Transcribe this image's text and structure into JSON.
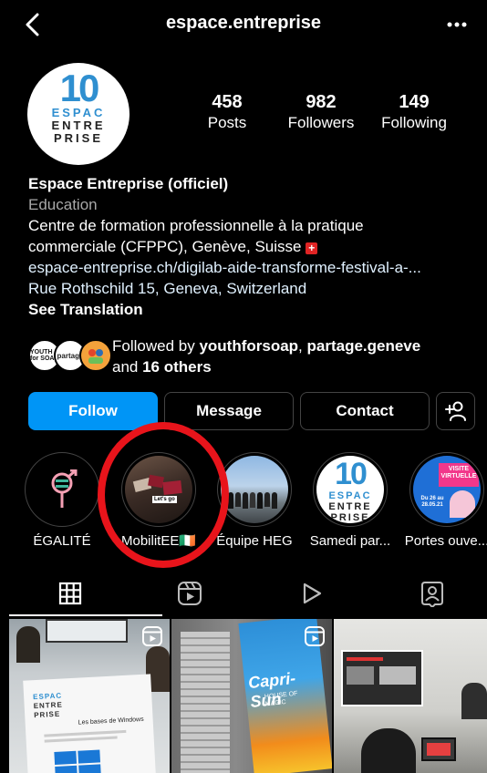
{
  "header": {
    "title": "espace.entreprise"
  },
  "profile": {
    "avatar_logo": {
      "number": "10",
      "line1": "ESPAC",
      "line2": "ENTRE",
      "line3": "PRISE"
    },
    "stats": [
      {
        "value": "458",
        "label": "Posts"
      },
      {
        "value": "982",
        "label": "Followers"
      },
      {
        "value": "149",
        "label": "Following"
      }
    ],
    "name": "Espace Entreprise (officiel)",
    "category": "Education",
    "bio_line1": "Centre de formation professionnelle à la pratique",
    "bio_line2": "commerciale (CFPPC), Genève, Suisse",
    "flag_glyph": "+",
    "link": "espace-entreprise.ch/digilab-aide-transforme-festival-a-...",
    "address": "Rue Rothschild 15, Geneva, Switzerland",
    "see_translation": "See Translation"
  },
  "followed_by": {
    "prefix": "Followed by ",
    "user1": "youthforsoap",
    "sep": ", ",
    "user2": "partage.geneve",
    "line2_prefix": "and ",
    "others": "16 others",
    "avatar1_text": "YOUTH for SOAP",
    "avatar2_text": "partage"
  },
  "buttons": {
    "follow": "Follow",
    "message": "Message",
    "contact": "Contact"
  },
  "highlights": [
    {
      "label": "ÉGALITÉ"
    },
    {
      "label": "MobilitEE🇮🇪",
      "inner_text": "Let's go"
    },
    {
      "label": "Équipe HEG"
    },
    {
      "label": "Samedi par..."
    },
    {
      "label": "Portes ouve...",
      "inner_text1": "VISITE VIRTUELLE",
      "inner_text2": "Du 26 au 28.05.21"
    }
  ],
  "posts": [
    {
      "doc_title": "Les bases de Windows",
      "logo_line1": "ESPAC",
      "logo_line2": "ENTRE",
      "logo_line3": "PRISE"
    },
    {
      "text": "Capri-Sun",
      "sub": "HOUSE OF MAGIC"
    },
    {
      "text": ""
    }
  ],
  "colors": {
    "accent": "#0095f6",
    "highlight_circle": "#e8141b",
    "logo_blue": "#2f8fd0"
  }
}
